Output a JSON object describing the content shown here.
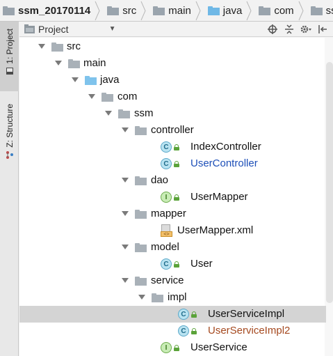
{
  "breadcrumbs": [
    {
      "label": "ssm_20170114",
      "icon": "folder-icon",
      "bold": true,
      "color": "#9aa4ad"
    },
    {
      "label": "src",
      "icon": "folder-icon",
      "color": "#9aa4ad"
    },
    {
      "label": "main",
      "icon": "folder-icon",
      "color": "#9aa4ad"
    },
    {
      "label": "java",
      "icon": "source-folder-icon",
      "color": "#6fb8e6"
    },
    {
      "label": "com",
      "icon": "package-icon",
      "color": "#9aa4ad"
    },
    {
      "label": "ss",
      "icon": "package-icon",
      "color": "#9aa4ad"
    }
  ],
  "toolstrip": {
    "project_tab": "1: Project",
    "structure_tab": "Z: Structure"
  },
  "project_panel": {
    "title": "Project",
    "view_dropdown_icon": "chevron-down-icon",
    "actions": [
      "target-icon",
      "collapse-all-icon",
      "gear-icon",
      "hide-icon"
    ]
  },
  "tree": [
    {
      "label": "src",
      "type": "folder",
      "expanded": true
    },
    {
      "label": "main",
      "type": "folder",
      "expanded": true
    },
    {
      "label": "java",
      "type": "source-folder",
      "expanded": true
    },
    {
      "label": "com",
      "type": "package",
      "expanded": true
    },
    {
      "label": "ssm",
      "type": "package",
      "expanded": true
    },
    {
      "label": "controller",
      "type": "package",
      "expanded": true
    },
    {
      "label": "IndexController",
      "type": "class",
      "status": "normal"
    },
    {
      "label": "UserController",
      "type": "class",
      "status": "modified"
    },
    {
      "label": "dao",
      "type": "package",
      "expanded": true
    },
    {
      "label": "UserMapper",
      "type": "interface",
      "status": "normal"
    },
    {
      "label": "mapper",
      "type": "package",
      "expanded": true
    },
    {
      "label": "UserMapper.xml",
      "type": "xml-file",
      "status": "normal"
    },
    {
      "label": "model",
      "type": "package",
      "expanded": true
    },
    {
      "label": "User",
      "type": "class",
      "status": "normal"
    },
    {
      "label": "service",
      "type": "package",
      "expanded": true
    },
    {
      "label": "impl",
      "type": "package",
      "expanded": true
    },
    {
      "label": "UserServiceImpl",
      "type": "class",
      "status": "normal",
      "selected": true
    },
    {
      "label": "UserServiceImpl2",
      "type": "class",
      "status": "unversioned"
    },
    {
      "label": "UserService",
      "type": "interface",
      "status": "normal"
    }
  ],
  "colors": {
    "modified": "#1d4fb8",
    "unversioned": "#a5491f",
    "selection": "#d4d4d4"
  }
}
